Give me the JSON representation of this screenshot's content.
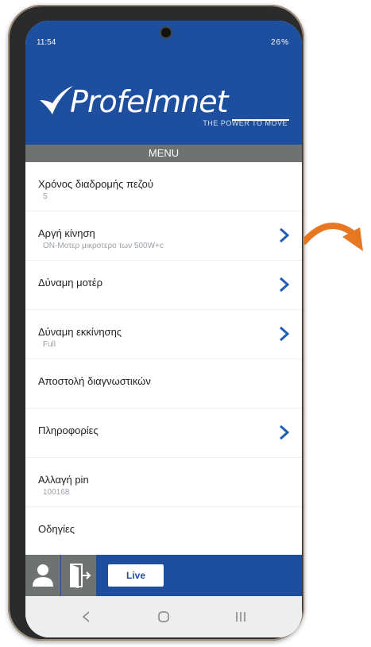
{
  "status": {
    "time": "11:54",
    "right_text": "26%"
  },
  "header": {
    "brand": "Profelmnet",
    "tagline": "THE POWER TO MOVE"
  },
  "menu_title": "MENU",
  "menu": [
    {
      "label": "Χρόνος διαδρομής πεζού",
      "value": "5",
      "chevron": false
    },
    {
      "label": "Αργή κίνηση",
      "value": "ON-Μοτερ μικροτερο των 500W+c",
      "chevron": true
    },
    {
      "label": "Δύναμη μοτέρ",
      "value": "",
      "chevron": true
    },
    {
      "label": "Δύναμη εκκίνησης",
      "value": "Full",
      "chevron": true
    },
    {
      "label": "Αποστολή διαγνωστικών",
      "value": "",
      "chevron": false
    },
    {
      "label": "Πληροφορίες",
      "value": "",
      "chevron": true
    },
    {
      "label": "Αλλαγή pin",
      "value": "100168",
      "chevron": false
    },
    {
      "label": "Οδηγίες",
      "value": "",
      "chevron": false
    }
  ],
  "bottom": {
    "live_label": "Live"
  },
  "colors": {
    "brand_blue": "#1e4f9e",
    "grey": "#6f7273",
    "arrow_orange": "#e87722"
  },
  "icons": [
    "person-icon",
    "exit-door-icon",
    "back-icon",
    "home-icon",
    "recents-icon",
    "curved-arrow-icon"
  ]
}
